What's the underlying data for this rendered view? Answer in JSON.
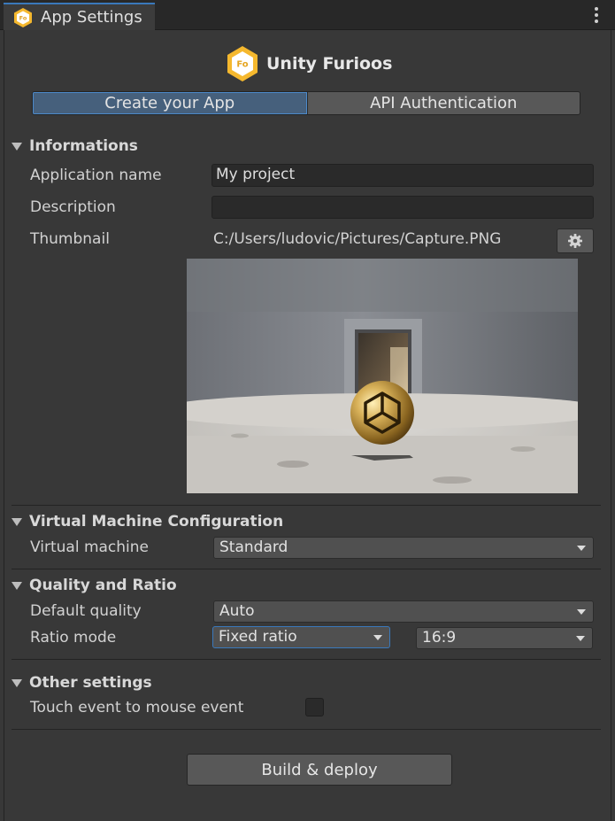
{
  "window": {
    "tab_title": "App Settings",
    "tab_icon": "furioos-logo-icon"
  },
  "brand": {
    "name": "Unity Furioos",
    "accent": "#f5b82e"
  },
  "tabs": [
    {
      "label": "Create your App",
      "active": true
    },
    {
      "label": "API Authentication",
      "active": false
    }
  ],
  "informations": {
    "header": "Informations",
    "app_name_label": "Application name",
    "app_name_value": "My project",
    "description_label": "Description",
    "description_value": "",
    "thumbnail_label": "Thumbnail",
    "thumbnail_path": "C:/Users/ludovic/Pictures/Capture.PNG",
    "thumbnail_button_icon": "gear-icon"
  },
  "vm": {
    "header": "Virtual Machine Configuration",
    "label": "Virtual machine",
    "value": "Standard"
  },
  "quality": {
    "header": "Quality and Ratio",
    "default_quality_label": "Default quality",
    "default_quality_value": "Auto",
    "ratio_mode_label": "Ratio mode",
    "ratio_mode_value": "Fixed ratio",
    "ratio_value": "16:9"
  },
  "other": {
    "header": "Other settings",
    "touch_label": "Touch event to mouse event",
    "touch_checked": false
  },
  "actions": {
    "build_label": "Build & deploy"
  },
  "colors": {
    "focus": "#3a79bb",
    "panel": "#383838"
  }
}
